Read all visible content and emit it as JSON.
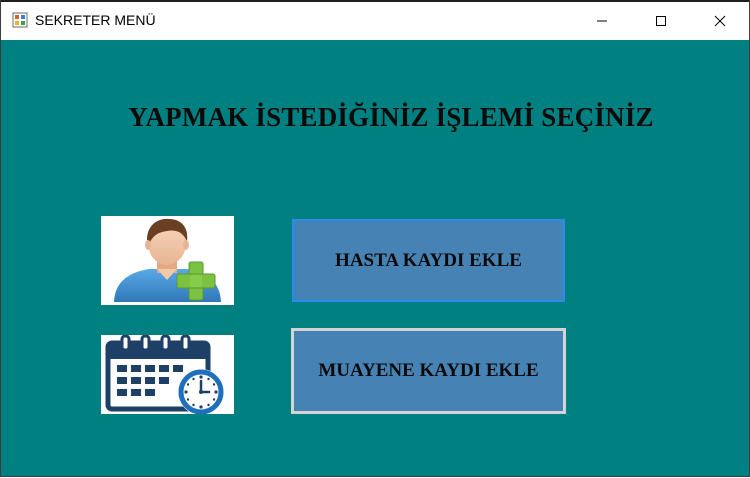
{
  "window": {
    "title": "SEKRETER MENÜ",
    "controls": {
      "minimize": "minimize-icon",
      "maximize": "maximize-icon",
      "close": "close-icon"
    }
  },
  "main": {
    "heading": "YAPMAK İSTEDİĞİNİZ İŞLEMİ SEÇİNİZ",
    "buttons": {
      "hasta_kaydi": "HASTA KAYDI EKLE",
      "muayene_kaydi": "MUAYENE KAYDI EKLE"
    },
    "images": {
      "patient": "add-user-icon",
      "appointment": "calendar-clock-icon"
    }
  },
  "colors": {
    "background": "#008080",
    "button": "#4682b4",
    "focus_border": "#2a8cf0"
  }
}
